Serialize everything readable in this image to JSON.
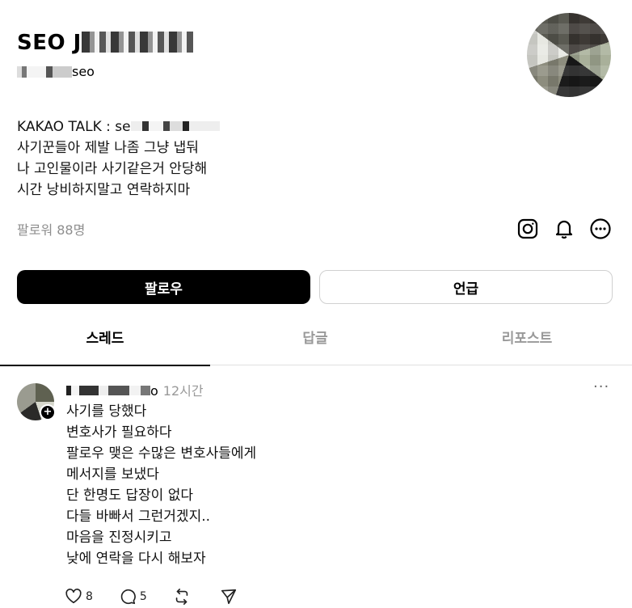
{
  "profile": {
    "name_prefix": "SEO J",
    "handle_suffix": "seo",
    "bio": {
      "line1_prefix": "KAKAO TALK : se",
      "line2": "사기꾼들아 제발 나좀 그냥 냅둬",
      "line3": "나 고인물이라 사기같은거 안당해",
      "line4": "시간 낭비하지말고 연락하지마"
    },
    "followers": "팔로워 88명",
    "icons": {
      "instagram": "instagram-icon",
      "notification": "bell-icon",
      "more": "more-circle-icon"
    }
  },
  "buttons": {
    "follow": "팔로우",
    "mention": "언급"
  },
  "tabs": [
    {
      "label": "스레드",
      "active": true
    },
    {
      "label": "답글",
      "active": false
    },
    {
      "label": "리포스트",
      "active": false
    }
  ],
  "post": {
    "user_suffix": "o",
    "time": "12시간",
    "more": "···",
    "lines": [
      "사기를 당했다",
      "변호사가 필요하다",
      "팔로우 맺은 수많은 변호사들에게",
      "메서지를 보냈다",
      "단 한명도 답장이 없다",
      "다들 바빠서 그런거겠지..",
      "마음을 진정시키고",
      "낮에 연락을 다시 해보자"
    ],
    "likes": "8",
    "comments": "5",
    "icons": {
      "like": "heart-icon",
      "comment": "comment-icon",
      "repost": "repost-icon",
      "share": "send-icon"
    }
  },
  "colors": {
    "primary_button": "#000000",
    "muted_text": "#8e8e8e",
    "divider": "#e0e0e0"
  }
}
